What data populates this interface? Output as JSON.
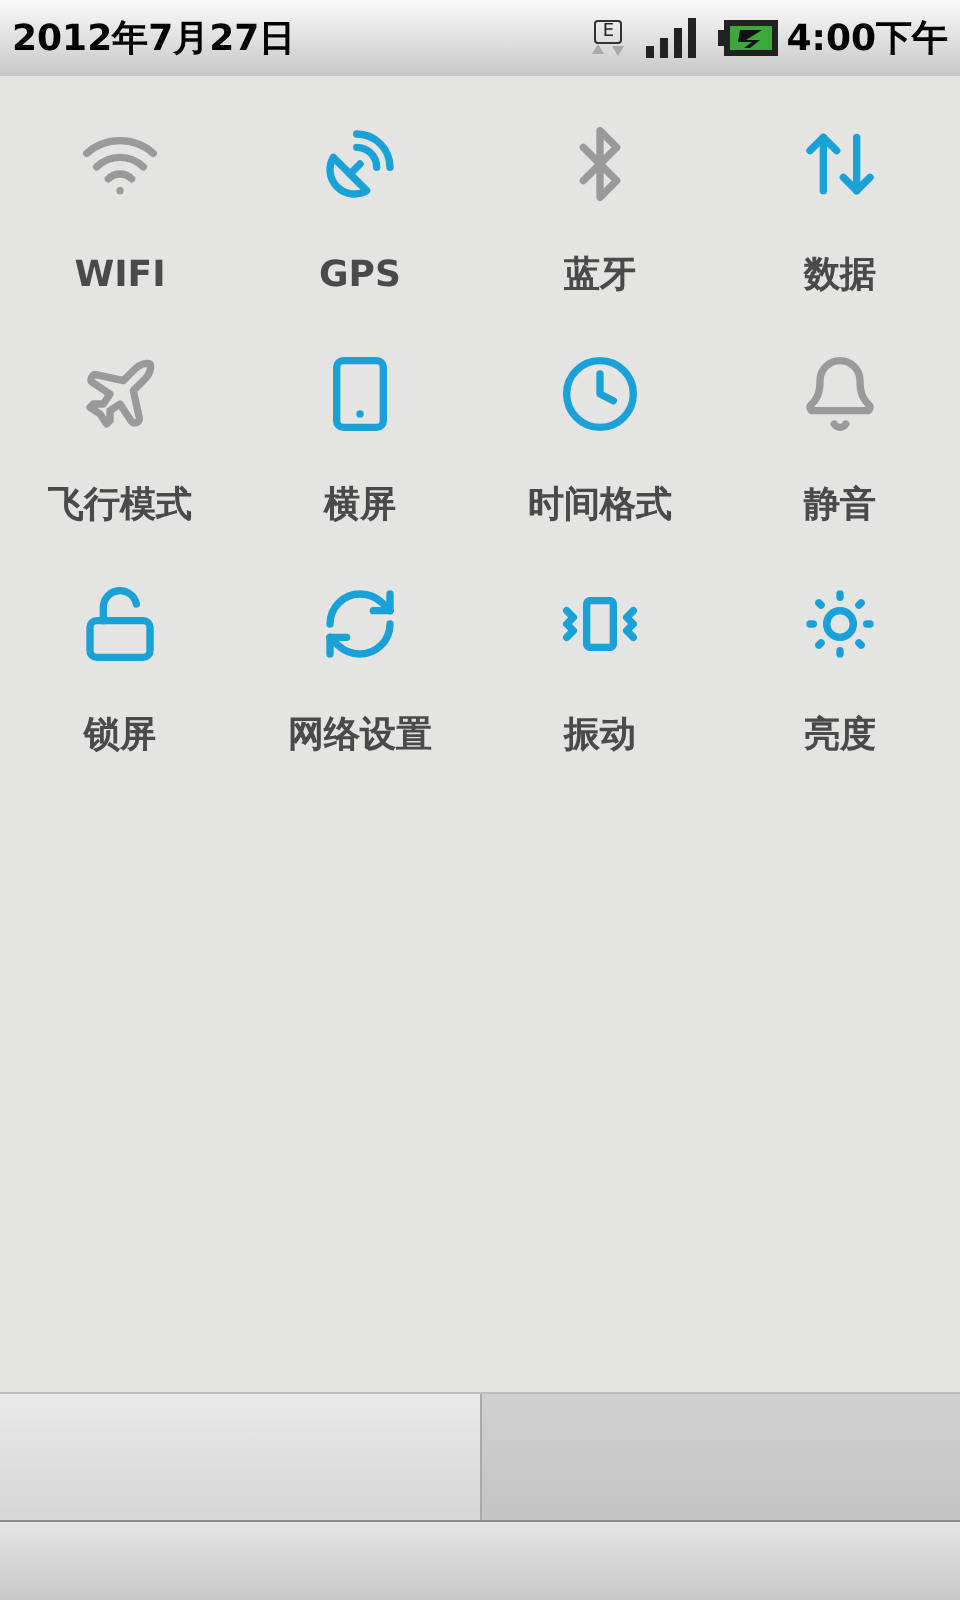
{
  "status_bar": {
    "date": "2012年7月27日",
    "network_type": "E",
    "time": "4:00下午"
  },
  "toggles": [
    {
      "label": "WIFI",
      "on": false
    },
    {
      "label": "GPS",
      "on": true
    },
    {
      "label": "蓝牙",
      "on": false
    },
    {
      "label": "数据",
      "on": true
    },
    {
      "label": "飞行模式",
      "on": false
    },
    {
      "label": "横屏",
      "on": true
    },
    {
      "label": "时间格式",
      "on": true
    },
    {
      "label": "静音",
      "on": false
    },
    {
      "label": "锁屏",
      "on": true
    },
    {
      "label": "网络设置",
      "on": true
    },
    {
      "label": "振动",
      "on": true
    },
    {
      "label": "亮度",
      "on": true
    }
  ],
  "bottom_tabs": [
    {
      "selected": true
    },
    {
      "selected": false
    }
  ]
}
